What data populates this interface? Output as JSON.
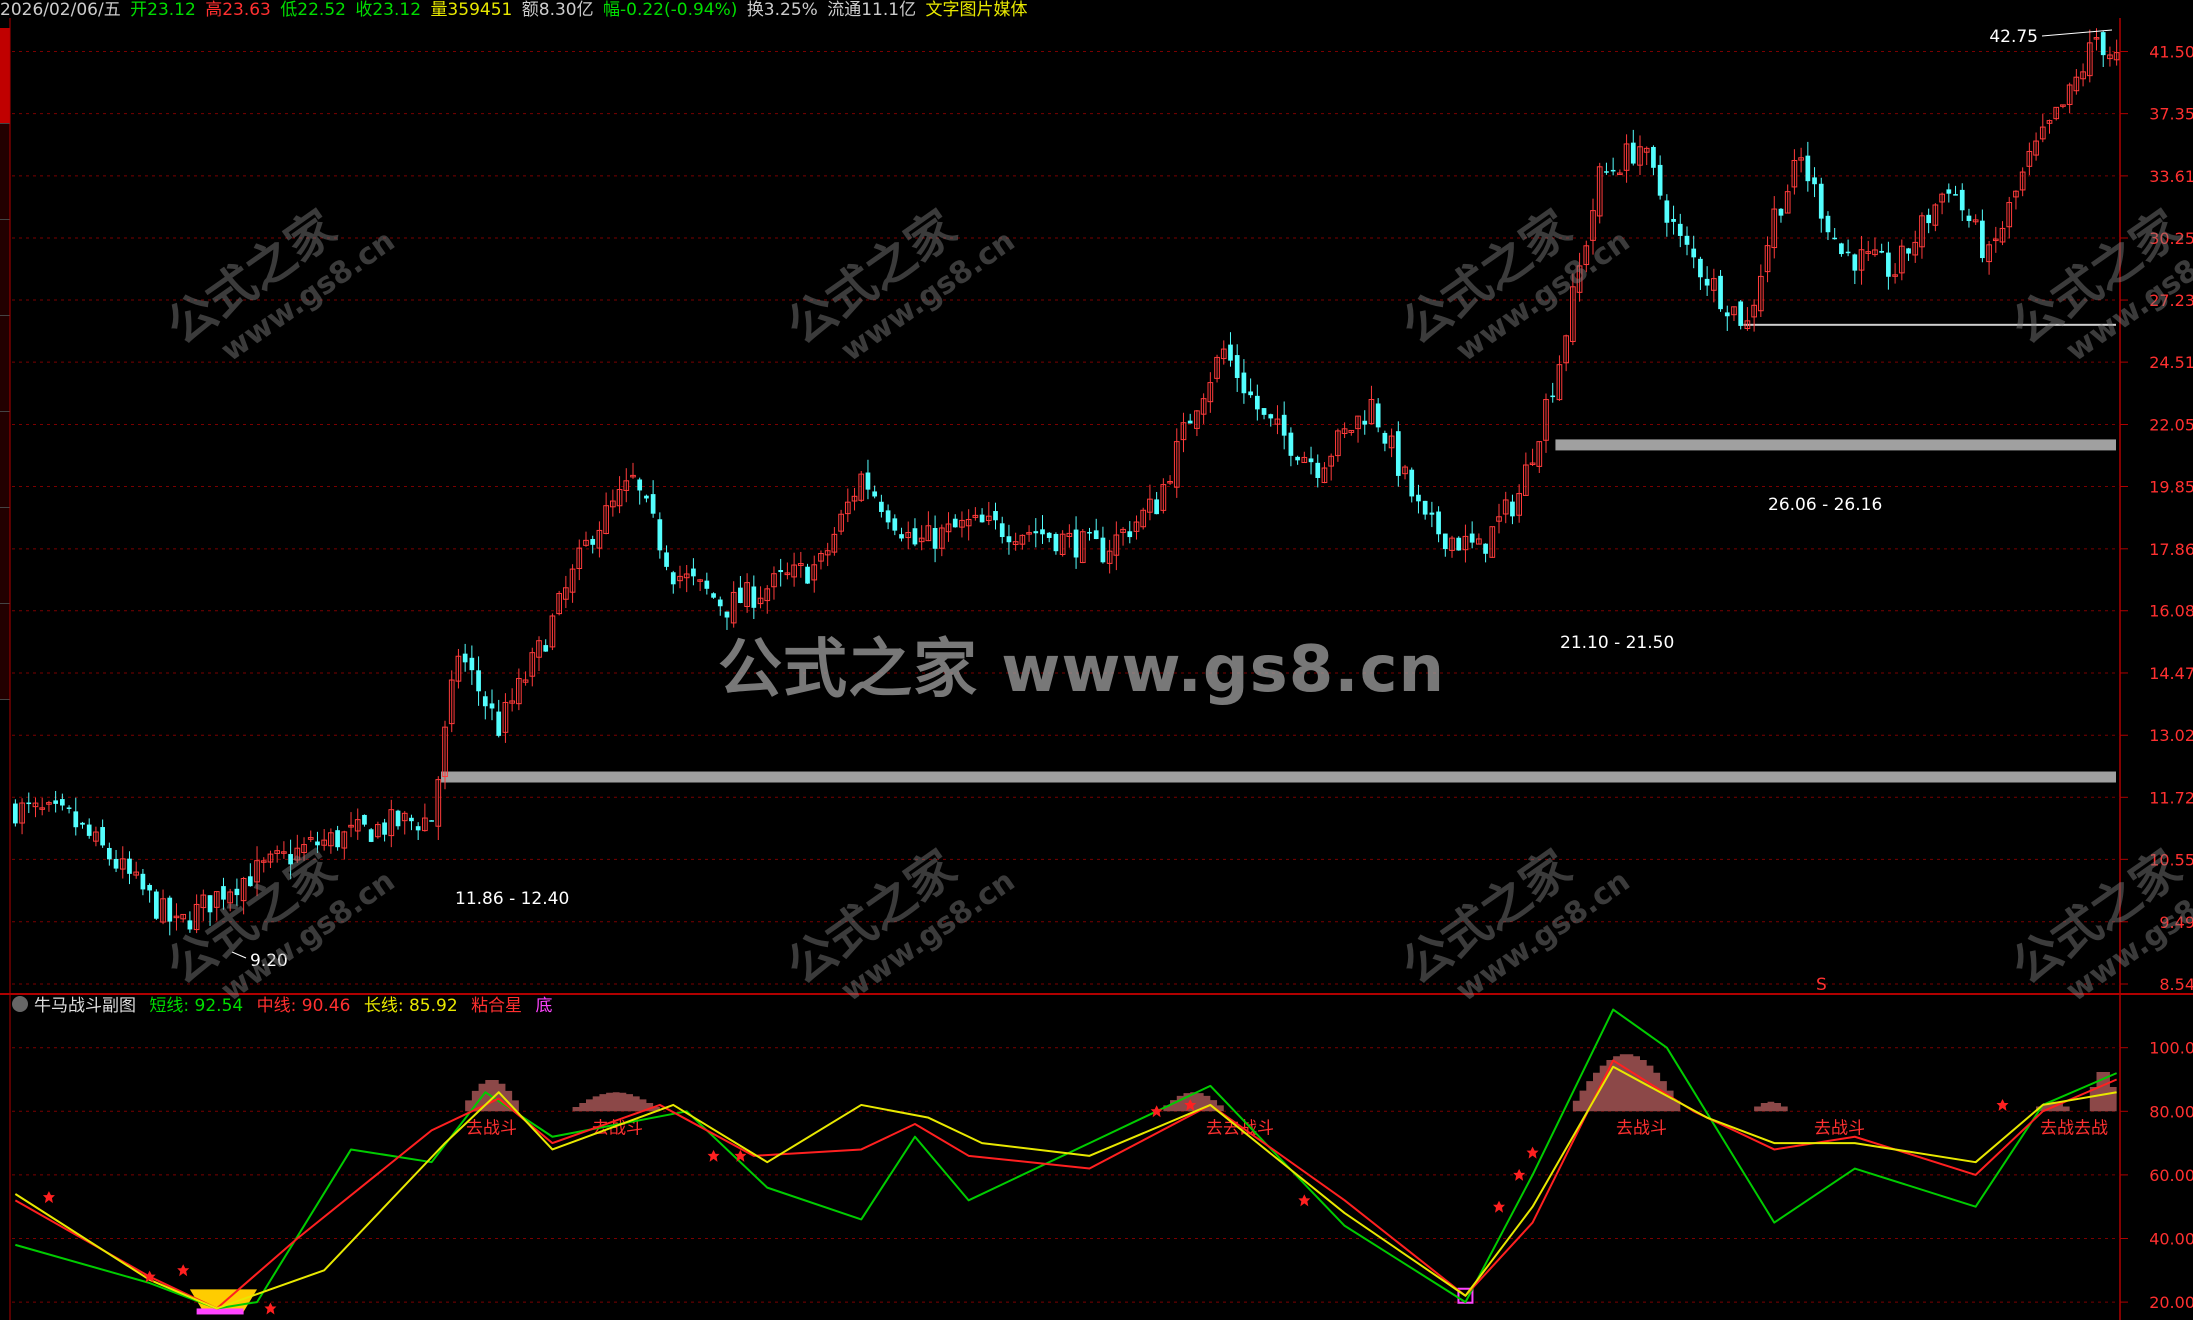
{
  "topbar": {
    "date": "2026/02/06/五",
    "open": "开23.12",
    "high": "高23.63",
    "low": "低22.52",
    "close": "收23.12",
    "volume": "量359451",
    "amount": "额8.30亿",
    "change": "幅-0.22(-0.94%)",
    "turnover": "换3.25%",
    "float": "流通11.1亿",
    "media": "文字图片媒体"
  },
  "colors": {
    "up": "#ff3b3b",
    "down": "#54ffff",
    "axis_red": "#b00000",
    "grid": "#7a0000",
    "short_line": "#00cc00",
    "mid_line": "#ff2020",
    "long_line": "#e8e800",
    "band": "#a0a0a0",
    "hump": "#8c4848"
  },
  "watermark": {
    "center": "公式之家 www.gs8.cn",
    "diag_cn": "公式之家",
    "diag_url": "www.gs8.cn"
  },
  "price_axis": [
    "41.50",
    "37.35",
    "33.61",
    "30.25",
    "27.23",
    "24.51",
    "22.05",
    "19.85",
    "17.86",
    "16.08",
    "14.47",
    "13.02",
    "11.72",
    "10.55",
    "9.49",
    "8.54"
  ],
  "annotations": {
    "peak": "42.75",
    "low": "9.20",
    "band1": "11.86 - 12.40",
    "band2": "21.10 - 21.50",
    "band3": "26.06 - 26.16",
    "s_mark": "S"
  },
  "indicator": {
    "title": "牛马战斗副图",
    "short_label": "短线: 92.54",
    "mid_label": "中线: 90.46",
    "long_label": "长线: 85.92",
    "pattern": "粘合星",
    "bottom": "底",
    "axis": [
      "100.0",
      "80.00",
      "60.00",
      "40.00",
      "20.00"
    ],
    "hump_label": "去战斗",
    "hump_label_double": "去去战斗",
    "hump_label_end": "去战去战"
  },
  "chart_data": [
    {
      "type": "candlestick",
      "title": "",
      "y_axis": "log price",
      "ylim": [
        8.54,
        42.75
      ],
      "max": 42.75,
      "min": 9.2,
      "support_bands": [
        [
          11.86,
          12.4
        ],
        [
          21.1,
          21.5
        ],
        [
          26.06,
          26.16
        ]
      ],
      "close_trend": [
        {
          "x": 0,
          "y": 11.5
        },
        {
          "x": 8,
          "y": 11.3
        },
        {
          "x": 14,
          "y": 10.6
        },
        {
          "x": 24,
          "y": 9.4
        },
        {
          "x": 32,
          "y": 10.1
        },
        {
          "x": 44,
          "y": 10.8
        },
        {
          "x": 56,
          "y": 11.2
        },
        {
          "x": 62,
          "y": 11.3
        },
        {
          "x": 66,
          "y": 15.0
        },
        {
          "x": 72,
          "y": 13.2
        },
        {
          "x": 78,
          "y": 15.0
        },
        {
          "x": 86,
          "y": 18.4
        },
        {
          "x": 92,
          "y": 20.0
        },
        {
          "x": 98,
          "y": 17.2
        },
        {
          "x": 106,
          "y": 16.2
        },
        {
          "x": 114,
          "y": 16.9
        },
        {
          "x": 120,
          "y": 17.4
        },
        {
          "x": 126,
          "y": 20.2
        },
        {
          "x": 134,
          "y": 18.0
        },
        {
          "x": 142,
          "y": 18.6
        },
        {
          "x": 152,
          "y": 18.4
        },
        {
          "x": 162,
          "y": 17.8
        },
        {
          "x": 170,
          "y": 19.3
        },
        {
          "x": 176,
          "y": 23.0
        },
        {
          "x": 180,
          "y": 25.0
        },
        {
          "x": 186,
          "y": 22.2
        },
        {
          "x": 194,
          "y": 20.6
        },
        {
          "x": 202,
          "y": 22.8
        },
        {
          "x": 210,
          "y": 18.6
        },
        {
          "x": 218,
          "y": 17.8
        },
        {
          "x": 224,
          "y": 19.6
        },
        {
          "x": 230,
          "y": 24.6
        },
        {
          "x": 236,
          "y": 33.5
        },
        {
          "x": 242,
          "y": 35.4
        },
        {
          "x": 248,
          "y": 30.0
        },
        {
          "x": 254,
          "y": 27.5
        },
        {
          "x": 258,
          "y": 26.1
        },
        {
          "x": 262,
          "y": 31.5
        },
        {
          "x": 266,
          "y": 34.5
        },
        {
          "x": 272,
          "y": 29.5
        },
        {
          "x": 280,
          "y": 28.6
        },
        {
          "x": 288,
          "y": 33.2
        },
        {
          "x": 294,
          "y": 29.2
        },
        {
          "x": 300,
          "y": 34.5
        },
        {
          "x": 306,
          "y": 38.5
        },
        {
          "x": 310,
          "y": 42.5
        },
        {
          "x": 313,
          "y": 41.0
        }
      ]
    },
    {
      "type": "line",
      "title": "牛马战斗副图",
      "ylim": [
        15,
        115
      ],
      "series": [
        {
          "name": "短线",
          "values": [
            {
              "x": 0,
              "y": 38
            },
            {
              "x": 20,
              "y": 26
            },
            {
              "x": 30,
              "y": 18
            },
            {
              "x": 36,
              "y": 20
            },
            {
              "x": 50,
              "y": 68
            },
            {
              "x": 62,
              "y": 64
            },
            {
              "x": 70,
              "y": 86
            },
            {
              "x": 80,
              "y": 72
            },
            {
              "x": 100,
              "y": 80
            },
            {
              "x": 112,
              "y": 56
            },
            {
              "x": 126,
              "y": 46
            },
            {
              "x": 134,
              "y": 72
            },
            {
              "x": 142,
              "y": 52
            },
            {
              "x": 160,
              "y": 70
            },
            {
              "x": 178,
              "y": 88
            },
            {
              "x": 198,
              "y": 44
            },
            {
              "x": 216,
              "y": 20
            },
            {
              "x": 226,
              "y": 60
            },
            {
              "x": 238,
              "y": 112
            },
            {
              "x": 246,
              "y": 100
            },
            {
              "x": 262,
              "y": 45
            },
            {
              "x": 274,
              "y": 62
            },
            {
              "x": 292,
              "y": 50
            },
            {
              "x": 302,
              "y": 82
            },
            {
              "x": 313,
              "y": 92
            }
          ]
        },
        {
          "name": "中线",
          "values": [
            {
              "x": 0,
              "y": 52
            },
            {
              "x": 20,
              "y": 28
            },
            {
              "x": 30,
              "y": 18
            },
            {
              "x": 42,
              "y": 40
            },
            {
              "x": 62,
              "y": 74
            },
            {
              "x": 72,
              "y": 84
            },
            {
              "x": 80,
              "y": 70
            },
            {
              "x": 96,
              "y": 82
            },
            {
              "x": 110,
              "y": 66
            },
            {
              "x": 126,
              "y": 68
            },
            {
              "x": 134,
              "y": 76
            },
            {
              "x": 142,
              "y": 66
            },
            {
              "x": 160,
              "y": 62
            },
            {
              "x": 178,
              "y": 82
            },
            {
              "x": 198,
              "y": 52
            },
            {
              "x": 216,
              "y": 22
            },
            {
              "x": 226,
              "y": 45
            },
            {
              "x": 238,
              "y": 96
            },
            {
              "x": 250,
              "y": 80
            },
            {
              "x": 262,
              "y": 68
            },
            {
              "x": 274,
              "y": 72
            },
            {
              "x": 292,
              "y": 60
            },
            {
              "x": 302,
              "y": 80
            },
            {
              "x": 313,
              "y": 90
            }
          ]
        },
        {
          "name": "长线",
          "values": [
            {
              "x": 0,
              "y": 54
            },
            {
              "x": 20,
              "y": 27
            },
            {
              "x": 30,
              "y": 18
            },
            {
              "x": 46,
              "y": 30
            },
            {
              "x": 64,
              "y": 70
            },
            {
              "x": 72,
              "y": 86
            },
            {
              "x": 80,
              "y": 68
            },
            {
              "x": 98,
              "y": 82
            },
            {
              "x": 112,
              "y": 64
            },
            {
              "x": 126,
              "y": 82
            },
            {
              "x": 136,
              "y": 78
            },
            {
              "x": 144,
              "y": 70
            },
            {
              "x": 160,
              "y": 66
            },
            {
              "x": 178,
              "y": 82
            },
            {
              "x": 198,
              "y": 48
            },
            {
              "x": 216,
              "y": 22
            },
            {
              "x": 226,
              "y": 50
            },
            {
              "x": 238,
              "y": 94
            },
            {
              "x": 252,
              "y": 78
            },
            {
              "x": 262,
              "y": 70
            },
            {
              "x": 274,
              "y": 70
            },
            {
              "x": 292,
              "y": 64
            },
            {
              "x": 302,
              "y": 82
            },
            {
              "x": 313,
              "y": 86
            }
          ]
        }
      ],
      "humps": [
        {
          "from": 66,
          "to": 75,
          "peak": 90
        },
        {
          "from": 82,
          "to": 96,
          "peak": 86
        },
        {
          "from": 170,
          "to": 180,
          "peak": 86
        },
        {
          "from": 231,
          "to": 248,
          "peak": 98
        },
        {
          "from": 258,
          "to": 264,
          "peak": 83
        },
        {
          "from": 300,
          "to": 306,
          "peak": 83
        },
        {
          "from": 308,
          "to": 313,
          "peak": 93
        }
      ]
    }
  ]
}
